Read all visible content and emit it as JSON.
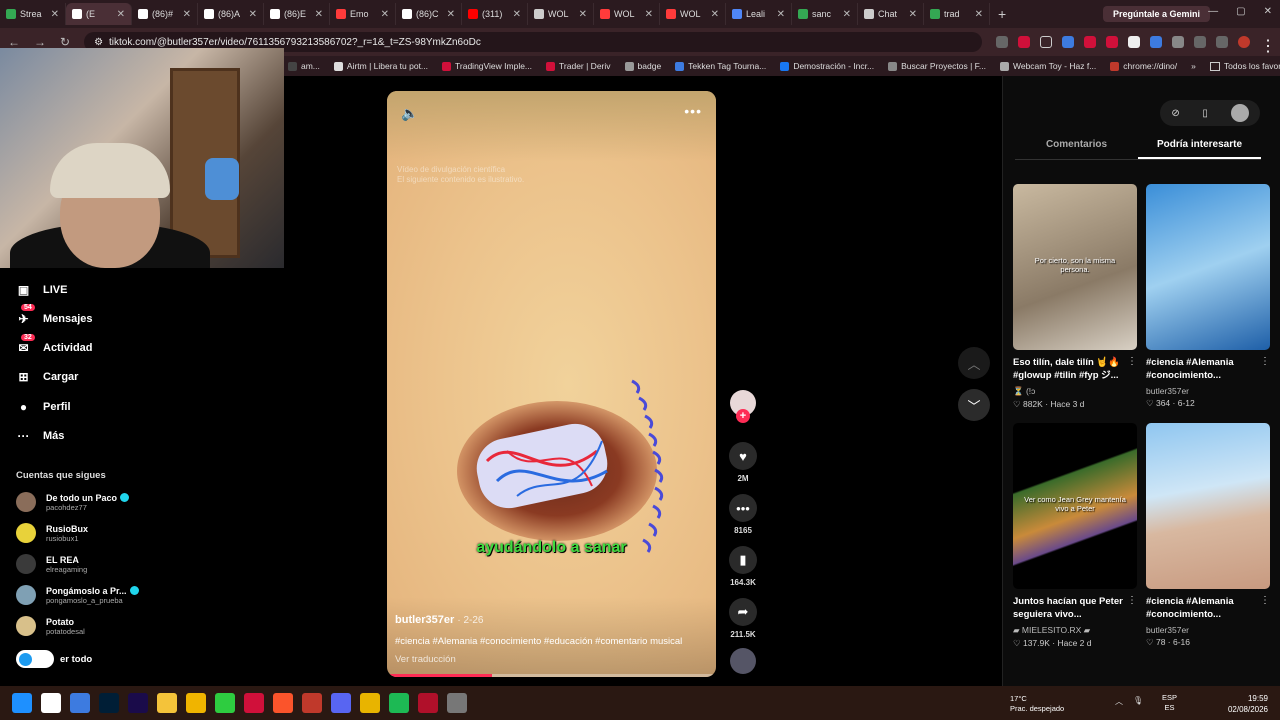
{
  "browser": {
    "tabs": [
      {
        "label": "Strea",
        "color": "#34a853"
      },
      {
        "label": "(E",
        "color": "#ffffff",
        "active": true
      },
      {
        "label": "(86)#",
        "color": "#ffffff"
      },
      {
        "label": "(86)A",
        "color": "#ffffff"
      },
      {
        "label": "(86)E",
        "color": "#ffffff"
      },
      {
        "label": "Emo",
        "color": "#ff3b3b"
      },
      {
        "label": "(86)C",
        "color": "#ffffff"
      },
      {
        "label": "(311)",
        "color": "#ff0000"
      },
      {
        "label": "WOL",
        "color": "#cccccc"
      },
      {
        "label": "WOL",
        "color": "#ff3b3b"
      },
      {
        "label": "WOL",
        "color": "#ff3b3b"
      },
      {
        "label": "Leali",
        "color": "#4f86f7"
      },
      {
        "label": "sanc",
        "color": "#34a853"
      },
      {
        "label": "Chat",
        "color": "#cccccc"
      },
      {
        "label": "trad",
        "color": "#34a853"
      }
    ],
    "new_tab": "+",
    "gemini_button": "Pregúntale a Gemini",
    "window_controls": [
      "—",
      "▢",
      "✕"
    ],
    "url": "tiktok.com/@butler357er/video/7611356793213586702?_r=1&_t=ZS-98YmkZn6oDc",
    "bookmarks": [
      "am...",
      "Airtm | Libera tu pot...",
      "TradingView Imple...",
      "Trader | Deriv",
      "badge",
      "Tekken Tag Tourna...",
      "Demostración - Incr...",
      "Buscar Proyectos | F...",
      "Webcam Toy - Haz f...",
      "chrome://dino/"
    ],
    "bookmarks_more": "»",
    "all_favorites": "Todos los favoritos"
  },
  "sidebar": {
    "nav": [
      {
        "label": "LIVE",
        "icon": "live-icon",
        "badge": ""
      },
      {
        "label": "Mensajes",
        "icon": "messages-icon",
        "badge": "54"
      },
      {
        "label": "Actividad",
        "icon": "activity-icon",
        "badge": "32"
      },
      {
        "label": "Cargar",
        "icon": "upload-icon",
        "badge": ""
      },
      {
        "label": "Perfil",
        "icon": "profile-icon",
        "badge": ""
      },
      {
        "label": "Más",
        "icon": "more-icon",
        "badge": ""
      }
    ],
    "following_title": "Cuentas que sigues",
    "following": [
      {
        "name": "De todo un Paco",
        "user": "pacohdez77",
        "verified": true,
        "avatar_color": "#8a6d5a"
      },
      {
        "name": "RusioBux",
        "user": "rusiobux1",
        "verified": false,
        "avatar_color": "#e8d23a"
      },
      {
        "name": "EL REA",
        "user": "elreagaming",
        "verified": false,
        "avatar_color": "#3a3a3a"
      },
      {
        "name": "Pongámoslo a Pr...",
        "user": "pongamoslo_a_prueba",
        "verified": true,
        "avatar_color": "#7fa0b4"
      },
      {
        "name": "Potato",
        "user": "potatodesal",
        "verified": false,
        "avatar_color": "#d8c08a"
      }
    ],
    "see_all": "er todo"
  },
  "video": {
    "faint_text_1": "Vídeo de divulgación científica",
    "faint_text_2": "El siguiente contenido es ilustrativo.",
    "caption": "ayudándolo a sanar",
    "author": "butler357er",
    "date": "· 2-26",
    "tags": "#ciencia #Alemania #conocimiento #educación #comentario musical",
    "translate": "Ver traducción",
    "progress": 0.32
  },
  "actions": {
    "likes": "2M",
    "comments": "8165",
    "saves": "164.3K",
    "shares": "211.5K"
  },
  "right_panel": {
    "tabs": [
      "Comentarios",
      "Podría interesarte"
    ],
    "active_tab": 1,
    "cards": [
      {
        "title": "Eso tilín, dale tilín 🤘🔥 #glowup #tilin #fyp ジ...",
        "author": "⏳ (!ɔ",
        "stats": "♡ 882K · Hace 3 d",
        "thumb_caption": "Por cierto, son la misma persona.",
        "bg": "linear-gradient(160deg,#c9b9a0,#8a7a66 60%,#d8d0c4)"
      },
      {
        "title": "#ciencia #Alemania #conocimiento...",
        "author": "butler357er",
        "stats": "♡ 364 · 6-12",
        "thumb_caption": "",
        "bg": "linear-gradient(160deg,#3a8ed8,#9fd0f0 50%,#1e5fa8)"
      },
      {
        "title": "Juntos hacían que Peter seguiera vivo...",
        "author": "▰ MIELESITO.RX ▰",
        "stats": "♡ 137.9K · Hace 2 d",
        "thumb_caption": "Ver como Jean Grey mantenía vivo a Peter",
        "bg": "linear-gradient(160deg,#000 0%,#000 33%,#3a6b2a 34%,#c98a3a 55%,#6a4a8a 67%,#000 68%)"
      },
      {
        "title": "#ciencia #Alemania #conocimiento...",
        "author": "butler357er",
        "stats": "♡ 78 · 6-16",
        "thumb_caption": "",
        "bg": "linear-gradient(170deg,#8fc6f0,#cfe6f6 40%,#d8b8a0 60%,#c89a80)"
      }
    ]
  },
  "taskbar": {
    "weather_temp": "17°C",
    "weather_desc": "Prac. despejado",
    "lang_1": "ESP",
    "lang_2": "ES",
    "time": "19:59",
    "date": "02/08/2026",
    "apps": [
      "#1e90ff",
      "#ffffff",
      "#3d7be0",
      "#001e36",
      "#1a0b4a",
      "#f4c33a",
      "#f0b400",
      "#2ecc40",
      "#d0103a",
      "#fb542b",
      "#c0392b",
      "#5865f2",
      "#e8b400",
      "#1db954",
      "#b0102a",
      "#777777"
    ]
  }
}
